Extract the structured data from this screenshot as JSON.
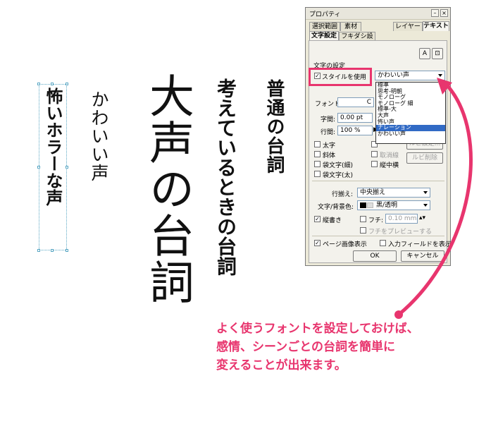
{
  "vertical_texts": {
    "normal": "普通の台詞",
    "thinking": "考えているときの台詞",
    "loud": "大声の台詞",
    "cute": "かわいい声",
    "horror": "怖いホラーな声"
  },
  "dialog": {
    "title": "プロパティ",
    "tabs_top": [
      "選択範囲",
      "素材",
      "レイヤー",
      "テキスト"
    ],
    "tabs_sub": [
      "文字設定",
      "フキダシ設定"
    ],
    "section_label": "文字の設定",
    "use_style_label": "スタイルを使用",
    "style_value": "かわいい声",
    "style_options": [
      "標準",
      "思考-明朝",
      "モノローグ",
      "モノローグ 細",
      "標準-大",
      "大声",
      "怖い声",
      "ナレーション",
      "かわいい声"
    ],
    "selected_option_index": 7,
    "font_label": "フォント:",
    "font_value": "C",
    "spacing_label": "字間:",
    "spacing_value": "0.00 pt",
    "line_label": "行間:",
    "line_value": "100 %",
    "bold_label": "太字",
    "italic_label": "斜体",
    "outline_thin_label": "袋文字(細)",
    "outline_thick_label": "袋文字(太)",
    "strike_label": "取消線",
    "tcy_label": "縦中横",
    "ruby_set_label": "ルビ設定...",
    "ruby_delete_label": "ルビ削除",
    "align_label": "行揃え:",
    "align_value": "中央揃え",
    "color_label": "文字/背景色:",
    "color_value": "黒/透明",
    "vertical_label": "縦書き",
    "border_label": "フチ:",
    "border_value": "0.10 mm",
    "border_preview_label": "フチをプレビューする",
    "page_image_label": "ページ画像表示",
    "input_field_label": "入力フィールドを表示",
    "ok_label": "OK",
    "cancel_label": "キャンセル"
  },
  "annotation": {
    "lines": [
      "よく使うフォントを設定しておけば、",
      "感情、シーンごとの台詞を簡単に",
      "変えることが出来ます。"
    ]
  },
  "colors": {
    "accent": "#e8356e",
    "selection": "#316ac5"
  }
}
